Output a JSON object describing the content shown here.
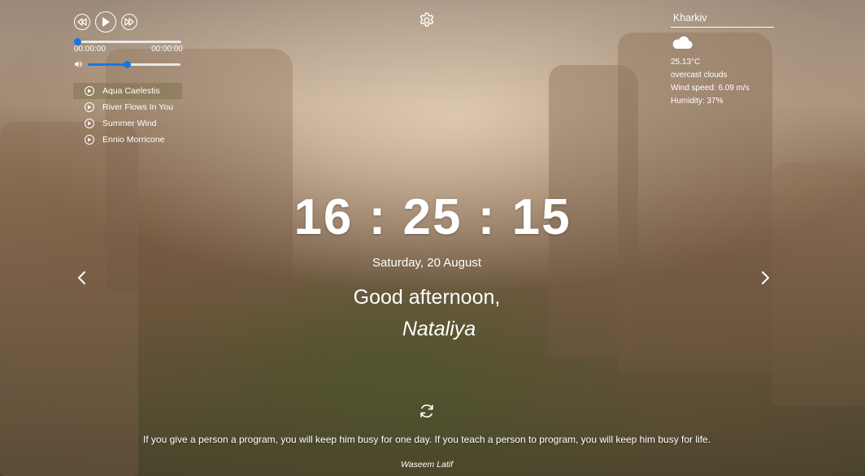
{
  "player": {
    "time_current": "00:00:00",
    "time_total": "00:00:00",
    "progress": 0,
    "volume": 0.42,
    "active_track_index": 0,
    "tracks": [
      "Aqua Caelestis",
      "River Flows In You",
      "Summer Wind",
      "Ennio Morricone"
    ]
  },
  "weather": {
    "city": "Kharkiv",
    "icon": "cloud-icon",
    "temperature": "25.13°C",
    "description": "overcast clouds",
    "wind": "Wind speed: 6.09 m/s",
    "humidity": "Humidity: 37%"
  },
  "clock": {
    "hours": "16",
    "minutes": "25",
    "seconds": "15"
  },
  "date": "Saturday, 20 August",
  "greeting": {
    "text": "Good afternoon,",
    "name": "Nataliya"
  },
  "quote": {
    "text": "If you give a person a program, you will keep him busy for one day. If you teach a person to program, you will keep him busy for life.",
    "author": "Waseem Latif"
  },
  "colors": {
    "accent": "#1a73e8",
    "text": "#ffffff"
  }
}
